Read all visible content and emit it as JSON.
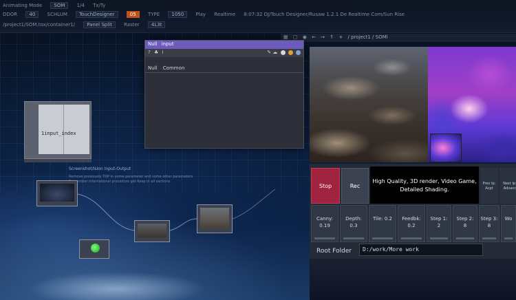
{
  "topbar": {
    "row1": [
      "Animating Mode",
      "SOM",
      "1/4",
      "Tx/Ty",
      "",
      "",
      ""
    ],
    "row2": [
      "DDOR",
      "40",
      "SCHLUM",
      "TouchDesigner",
      "05",
      "TYPE",
      "1050",
      "Play",
      "Realtime",
      "8:07:32 DJ/Touch Designer/Rusaw 1.2.1 De Realtime Com/Sun Rise"
    ],
    "row3": [
      "/project1/SOM.tox/container1/",
      "Panel Split",
      "Raster",
      "4L3t",
      "/ project1 / SOMl"
    ],
    "fields": {
      "field_orange": "05"
    }
  },
  "viewer_toolbar": {
    "path": "/ project1 / SOMl"
  },
  "null_panel": {
    "title": "Null",
    "title_sub": "input",
    "tabs": [
      "Null",
      "Common"
    ]
  },
  "control_panel": {
    "stop_label": "Stop",
    "rec_label": "Rec",
    "prompt": "High Quality, 3D render, Video Game, Detailed Shading.",
    "side1": "Prev Ip: Acpt",
    "side2": "Next Ip: Advanc",
    "params": [
      {
        "label": "Canny:",
        "value": "0.19"
      },
      {
        "label": "Depth:",
        "value": "0.3"
      },
      {
        "label": "Tile: 0.2",
        "value": ""
      },
      {
        "label": "Feedbk:",
        "value": "0.2"
      },
      {
        "label": "Step 1:",
        "value": "2"
      },
      {
        "label": "Step 2:",
        "value": "8"
      },
      {
        "label": "Step 3:",
        "value": "8"
      },
      {
        "label": "Wo",
        "value": ""
      }
    ],
    "root_folder_label": "Root Folder",
    "root_folder_value": "D:/work/More work"
  },
  "node_graph": {
    "input_index_label": "1input_index",
    "info_title": "Screenshot/Ision Input-Output",
    "info_lines": [
      "Remove previously TOP in some parameter and some other parameters",
      "Remember international procedure get Keep in all sections"
    ]
  }
}
